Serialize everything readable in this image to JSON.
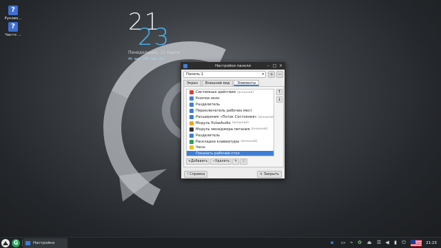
{
  "desktop": {
    "icons": [
      {
        "label": "Руково...",
        "icon": "help-book-icon"
      },
      {
        "label": "Часто ...",
        "icon": "help-faq-icon"
      }
    ]
  },
  "clock_widget": {
    "hours": "21",
    "minutes": "23",
    "date": "Понедельник, 11 марта",
    "stats": "4% mem 23% cpu 6%"
  },
  "dialog": {
    "title": "Настройки панели",
    "panel_select": "Панель 1",
    "tabs": [
      "Экран",
      "Внешний вид",
      "Элементы"
    ],
    "active_tab": "Элементы",
    "items": [
      {
        "label": "Системные действия",
        "ext": "(внешний)",
        "color": "#d9412f"
      },
      {
        "label": "Кнопки окон",
        "ext": "",
        "color": "#3d7fd6"
      },
      {
        "label": "Разделитель",
        "ext": "",
        "color": "#3d7fd6"
      },
      {
        "label": "Переключатель рабочих мест",
        "ext": "",
        "color": "#3d7fd6"
      },
      {
        "label": "Расширение «Поток Состояния»",
        "ext": "(внешний)",
        "color": "#3d7fd6"
      },
      {
        "label": "Модуль PulseAudio",
        "ext": "(внешний)",
        "color": "#f2a227"
      },
      {
        "label": "Модуль менеджера питания",
        "ext": "(внешний)",
        "color": "#333333"
      },
      {
        "label": "Разделитель",
        "ext": "",
        "color": "#3d7fd6"
      },
      {
        "label": "Раскладки клавиатуры",
        "ext": "(внешний)",
        "color": "#2f9e5b"
      },
      {
        "label": "Часы",
        "ext": "",
        "color": "#e8c22e"
      },
      {
        "label": "Показать рабочий стол",
        "ext": "",
        "color": "#3d7fd6",
        "selected": true
      }
    ],
    "add_label": "Добавить",
    "remove_label": "Удалить",
    "help_label": "Справка",
    "close_label": "Закрыть"
  },
  "taskbar": {
    "task_label": "Настройки панели",
    "time": "21:23"
  }
}
